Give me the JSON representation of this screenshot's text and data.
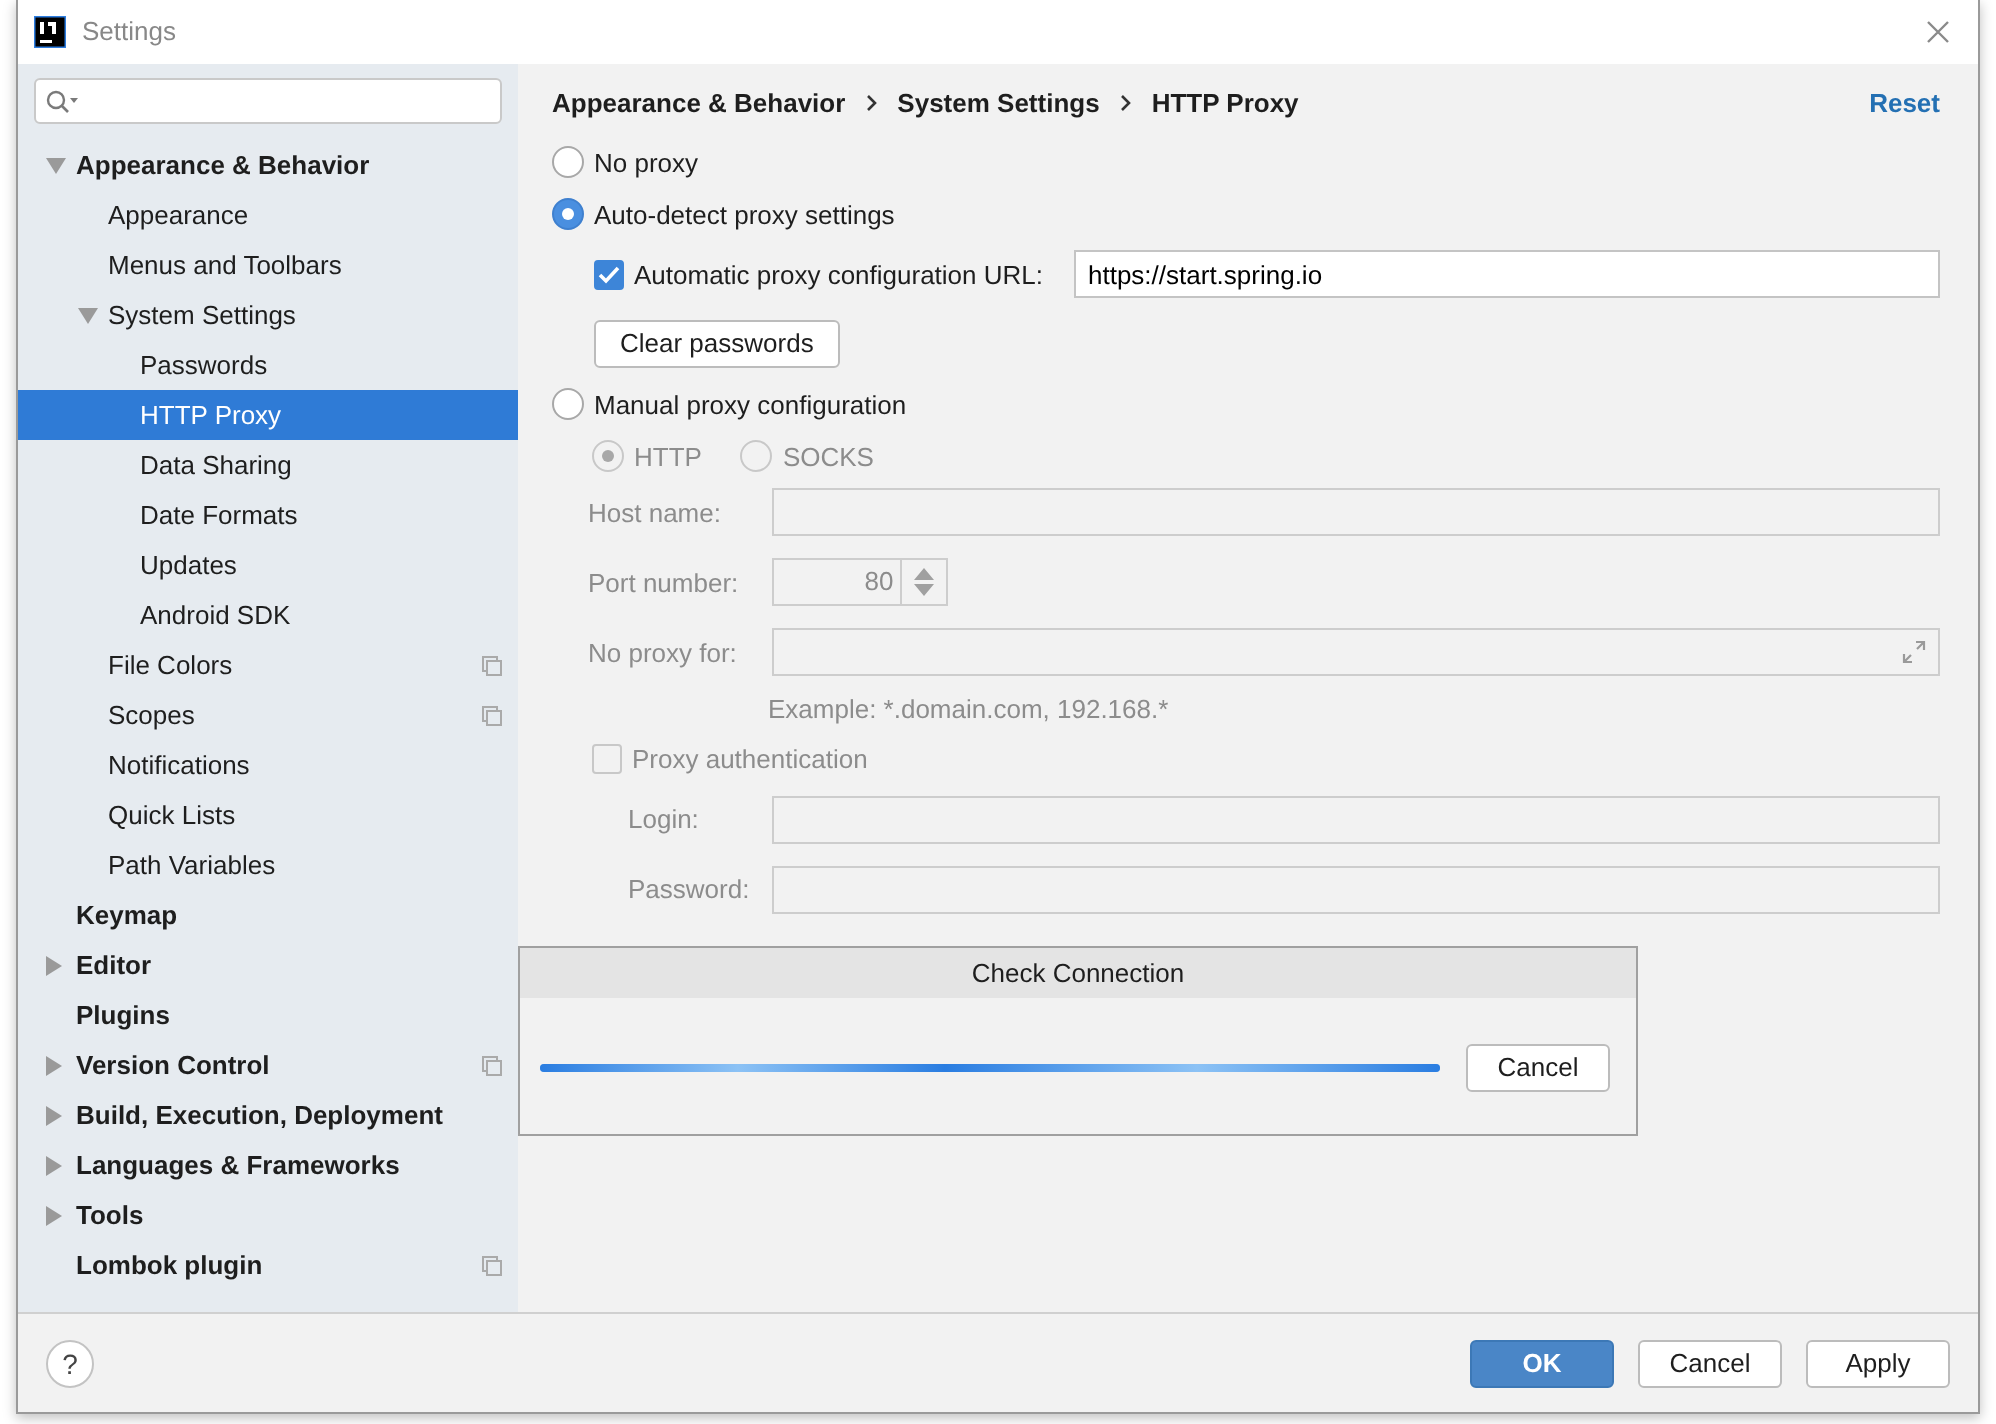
{
  "window": {
    "title": "Settings"
  },
  "sidebar": {
    "items": [
      {
        "label": "Appearance & Behavior",
        "expanded": true,
        "selected": false,
        "project_icon": false,
        "children": [
          {
            "label": "Appearance",
            "selected": false,
            "project_icon": false
          },
          {
            "label": "Menus and Toolbars",
            "selected": false,
            "project_icon": false
          },
          {
            "label": "System Settings",
            "expanded": true,
            "selected": false,
            "project_icon": false,
            "children": [
              {
                "label": "Passwords",
                "selected": false,
                "project_icon": false
              },
              {
                "label": "HTTP Proxy",
                "selected": true,
                "project_icon": false
              },
              {
                "label": "Data Sharing",
                "selected": false,
                "project_icon": false
              },
              {
                "label": "Date Formats",
                "selected": false,
                "project_icon": false
              },
              {
                "label": "Updates",
                "selected": false,
                "project_icon": false
              },
              {
                "label": "Android SDK",
                "selected": false,
                "project_icon": false
              }
            ]
          },
          {
            "label": "File Colors",
            "selected": false,
            "project_icon": true
          },
          {
            "label": "Scopes",
            "selected": false,
            "project_icon": true
          },
          {
            "label": "Notifications",
            "selected": false,
            "project_icon": false
          },
          {
            "label": "Quick Lists",
            "selected": false,
            "project_icon": false
          },
          {
            "label": "Path Variables",
            "selected": false,
            "project_icon": false
          }
        ]
      },
      {
        "label": "Keymap",
        "selected": false,
        "project_icon": false
      },
      {
        "label": "Editor",
        "expanded": false,
        "selected": false,
        "project_icon": false
      },
      {
        "label": "Plugins",
        "selected": false,
        "project_icon": false
      },
      {
        "label": "Version Control",
        "expanded": false,
        "selected": false,
        "project_icon": true
      },
      {
        "label": "Build, Execution, Deployment",
        "expanded": false,
        "selected": false,
        "project_icon": false
      },
      {
        "label": "Languages & Frameworks",
        "expanded": false,
        "selected": false,
        "project_icon": false
      },
      {
        "label": "Tools",
        "expanded": false,
        "selected": false,
        "project_icon": false
      },
      {
        "label": "Lombok plugin",
        "selected": false,
        "project_icon": true
      }
    ]
  },
  "breadcrumb": [
    "Appearance & Behavior",
    "System Settings",
    "HTTP Proxy"
  ],
  "reset": "Reset",
  "proxy_options": [
    {
      "label": "No proxy",
      "selected": false
    },
    {
      "label": "Auto-detect proxy settings",
      "selected": true
    },
    {
      "label": "Manual proxy configuration",
      "selected": false
    }
  ],
  "auto": {
    "label": "Automatic proxy configuration URL:",
    "checked": true,
    "url": "https://start.spring.io",
    "clear_button": "Clear passwords"
  },
  "manual": {
    "disabled": true,
    "protocols": [
      {
        "label": "HTTP",
        "selected": true
      },
      {
        "label": "SOCKS",
        "selected": false
      }
    ],
    "host_label": "Host name:",
    "port_label": "Port number:",
    "port": "80",
    "no_proxy_label": "No proxy for:",
    "example": "Example: *.domain.com, 192.168.*",
    "auth": {
      "label": "Proxy authentication",
      "checked": false
    },
    "login_label": "Login:",
    "password_label": "Password:"
  },
  "progress_dialog": {
    "title": "Check Connection",
    "level": 1,
    "cancel": "Cancel"
  },
  "footer": {
    "help": "?",
    "buttons": [
      {
        "label": "OK",
        "kind": "primary"
      },
      {
        "label": "Cancel",
        "kind": "default"
      },
      {
        "label": "Apply",
        "kind": "default"
      }
    ]
  }
}
